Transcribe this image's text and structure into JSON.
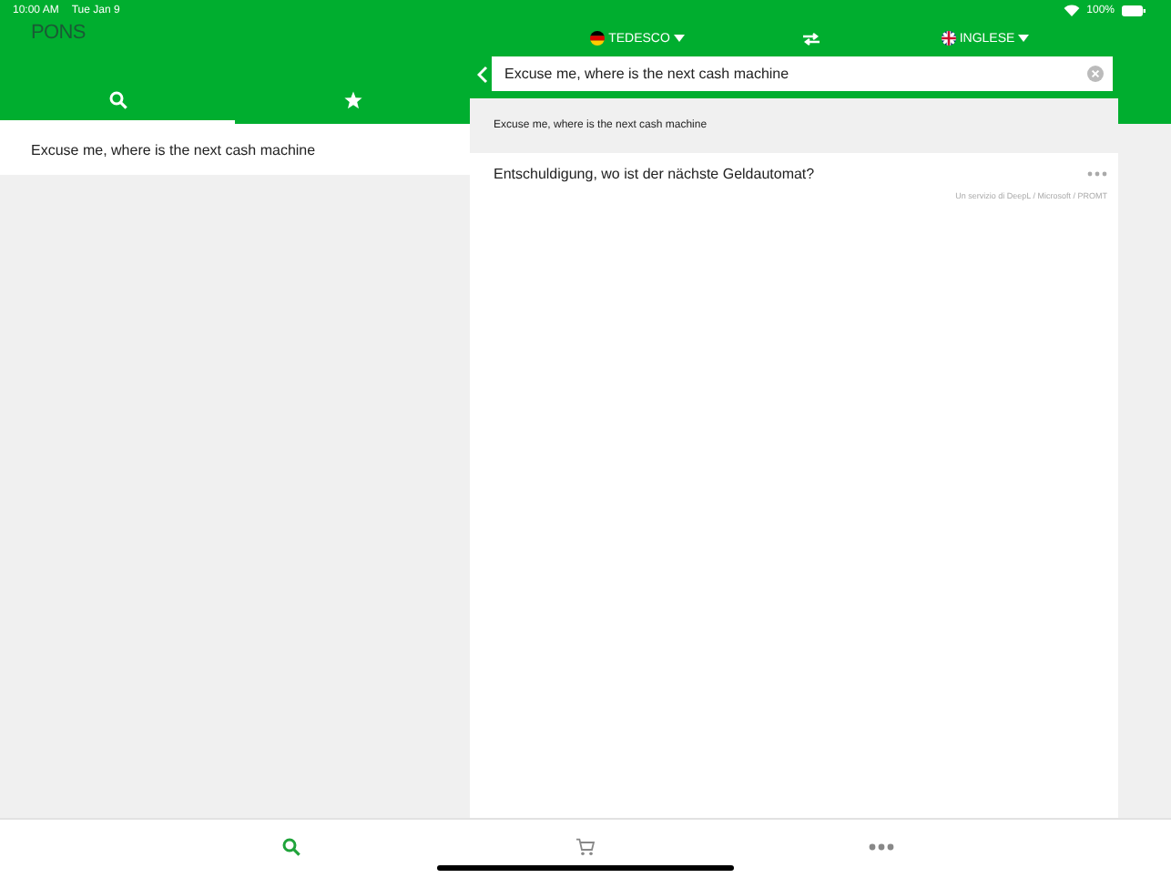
{
  "status_bar": {
    "time": "10:00 AM",
    "date": "Tue Jan 9",
    "battery": "100%"
  },
  "app": {
    "logo": "PONS"
  },
  "tabs": [
    {
      "kind": "search",
      "selected": true
    },
    {
      "kind": "favorites",
      "selected": false
    }
  ],
  "history": [
    {
      "text": "Excuse me, where is the next cash machine"
    }
  ],
  "languages": {
    "source": {
      "name": "TEDESCO",
      "kind": "de"
    },
    "target": {
      "name": "INGLESE",
      "kind": "gb"
    }
  },
  "search": {
    "value": "Excuse me, where is the next cash machine"
  },
  "result": {
    "source_text": "Excuse me, where is the next cash machine",
    "translation": "Entschuldigung, wo ist der nächste Geldautomat?",
    "attribution": "Un servizio di DeepL / Microsoft / PROMT"
  },
  "bottom_nav": [
    {
      "kind": "search",
      "selected": true
    },
    {
      "kind": "cart",
      "selected": false
    },
    {
      "kind": "more",
      "selected": false
    }
  ]
}
